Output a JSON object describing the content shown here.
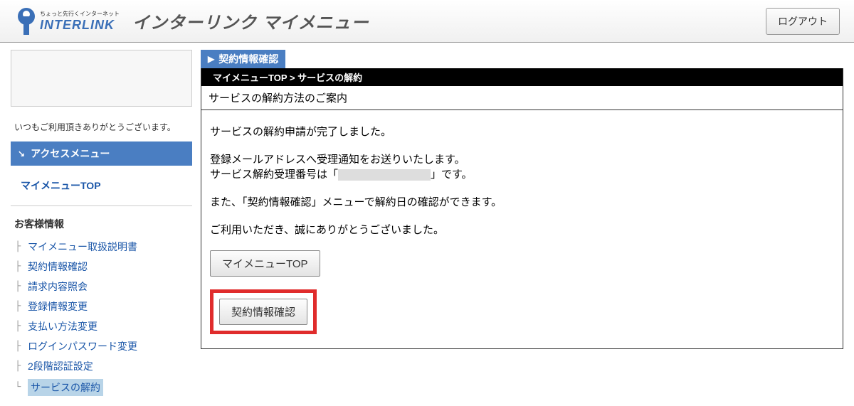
{
  "header": {
    "logo_tagline": "ちょっと先行くインターネット",
    "logo_brand": "INTERLINK",
    "page_title": "インターリンク マイメニュー",
    "logout_label": "ログアウト"
  },
  "sidebar": {
    "greeting": "いつもご利用頂きありがとうございます。",
    "access_menu_title": "アクセスメニュー",
    "mymenu_top_label": "マイメニューTOP",
    "customer_info_title": "お客様情報",
    "nav_items": [
      {
        "label": "マイメニュー取扱説明書",
        "active": false
      },
      {
        "label": "契約情報確認",
        "active": false
      },
      {
        "label": "請求内容照会",
        "active": false
      },
      {
        "label": "登録情報変更",
        "active": false
      },
      {
        "label": "支払い方法変更",
        "active": false
      },
      {
        "label": "ログインパスワード変更",
        "active": false
      },
      {
        "label": "2段階認証設定",
        "active": false
      },
      {
        "label": "サービスの解約",
        "active": true
      }
    ]
  },
  "main": {
    "content_header": "契約情報確認",
    "breadcrumb": "マイメニューTOP  >  サービスの解約",
    "subtitle": "サービスの解約方法のご案内",
    "body": {
      "line1": "サービスの解約申請が完了しました。",
      "line2": "登録メールアドレスへ受理通知をお送りいたします。",
      "line3_prefix": "サービス解約受理番号は「",
      "line3_suffix": "」です。",
      "line4": "また、「契約情報確認」メニューで解約日の確認ができます。",
      "line5": "ご利用いただき、誠にありがとうございました。"
    },
    "btn_mymenu_top": "マイメニューTOP",
    "btn_contract_confirm": "契約情報確認"
  }
}
